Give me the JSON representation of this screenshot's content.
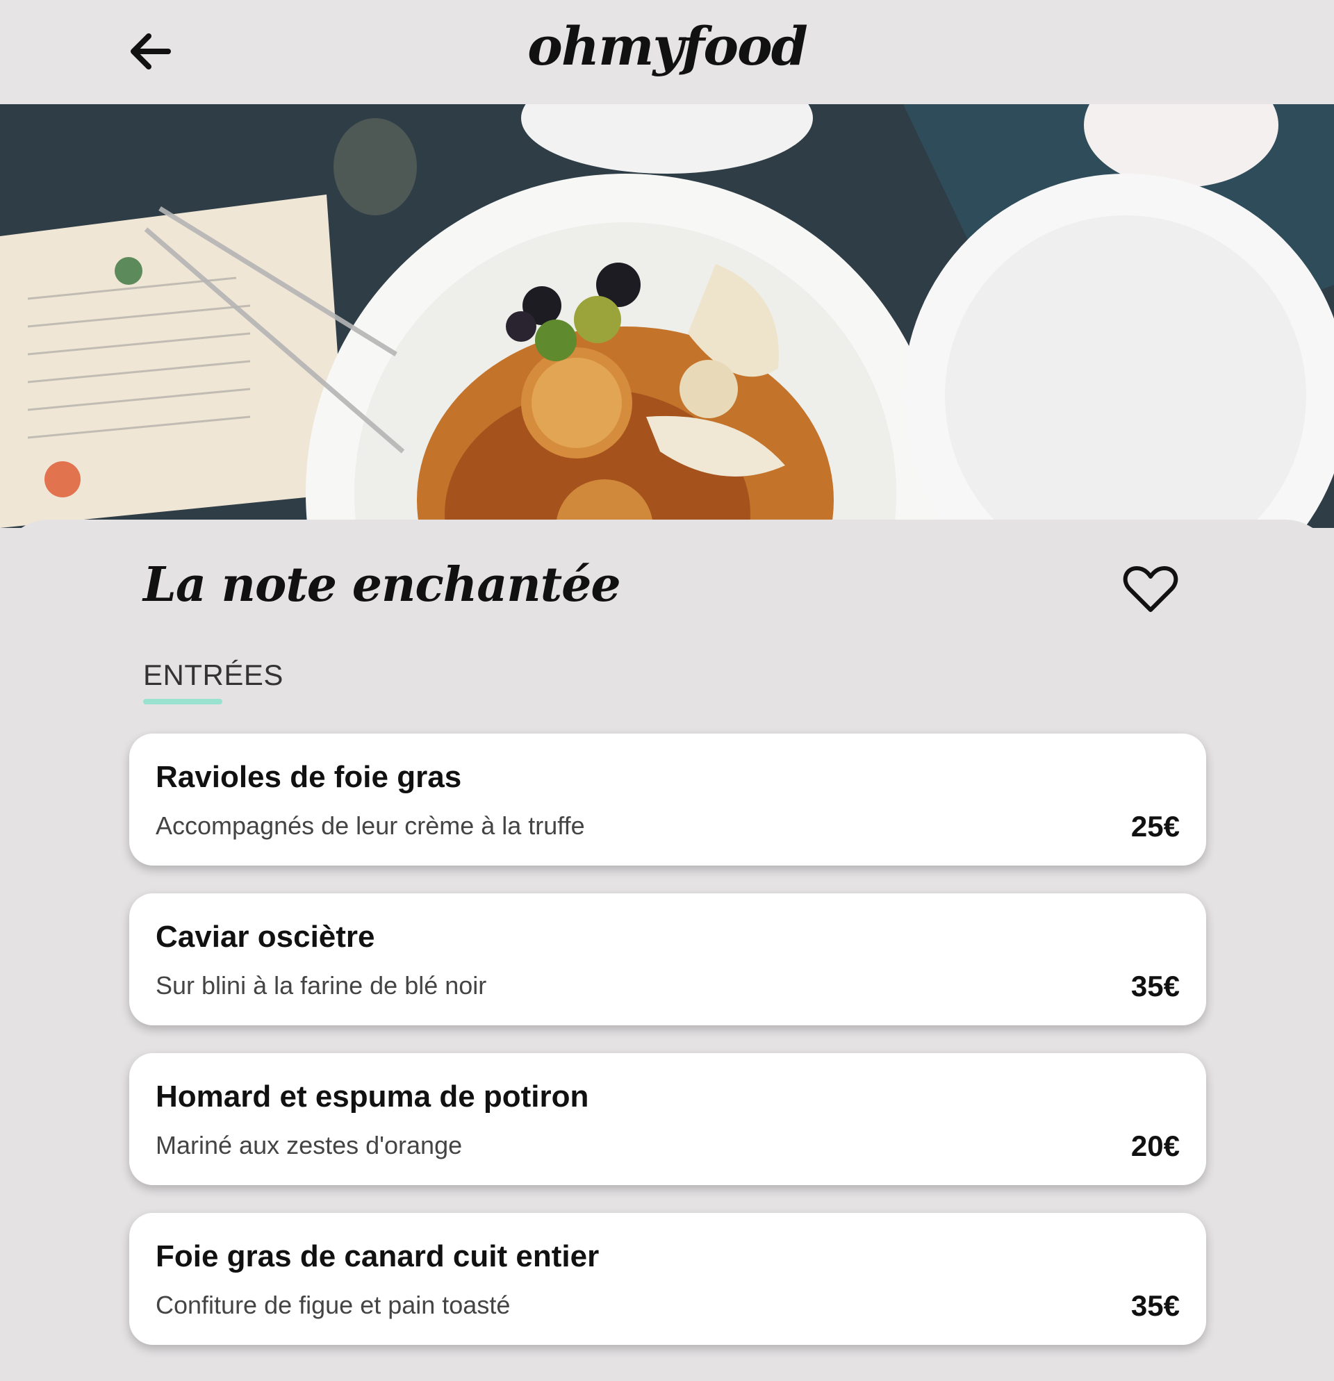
{
  "header": {
    "brand": "ohmyfood",
    "back_icon": "arrow-left-icon"
  },
  "hero": {
    "image": "hero-food-photo"
  },
  "restaurant": {
    "title": "La note enchantée",
    "favorite_icon": "heart-outline-icon"
  },
  "section": {
    "label": "ENTRÉES",
    "accent_color": "#99e2d0"
  },
  "menu": {
    "items": [
      {
        "name": "Ravioles de foie gras",
        "description": "Accompagnés de leur crème à la truffe",
        "price": "25€"
      },
      {
        "name": "Caviar osciètre",
        "description": "Sur blini à la farine de blé noir",
        "price": "35€"
      },
      {
        "name": "Homard et espuma de potiron",
        "description": "Mariné aux zestes d'orange",
        "price": "20€"
      },
      {
        "name": "Foie gras de canard cuit entier",
        "description": "Confiture de figue et pain toasté",
        "price": "35€"
      }
    ]
  }
}
